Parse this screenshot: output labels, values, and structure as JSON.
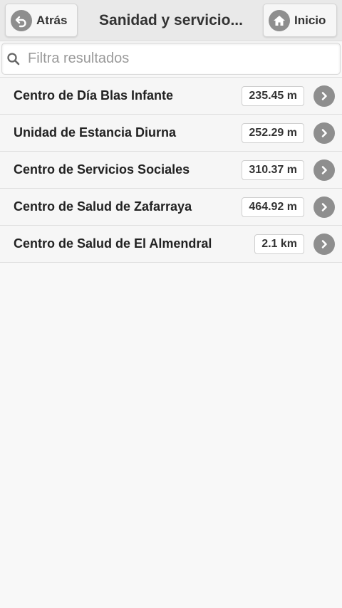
{
  "header": {
    "back_label": "Atrás",
    "title": "Sanidad y servicio...",
    "home_label": "Inicio"
  },
  "search": {
    "placeholder": "Filtra resultados",
    "value": ""
  },
  "results": [
    {
      "name": "Centro de Día Blas Infante",
      "distance": "235.45 m"
    },
    {
      "name": "Unidad de Estancia Diurna",
      "distance": "252.29 m"
    },
    {
      "name": "Centro de Servicios Sociales",
      "distance": "310.37 m"
    },
    {
      "name": "Centro de Salud de Zafarraya",
      "distance": "464.92 m"
    },
    {
      "name": "Centro de Salud de El Almendral",
      "distance": "2.1 km"
    }
  ],
  "icons": {
    "back": "back-arrow-icon",
    "home": "home-icon",
    "search": "search-icon",
    "row_arrow": "chevron-right-icon"
  },
  "colors": {
    "header_bg": "#e9e9e9",
    "icon_gray": "#8e8e8e",
    "row_bg": "#f6f6f6"
  }
}
